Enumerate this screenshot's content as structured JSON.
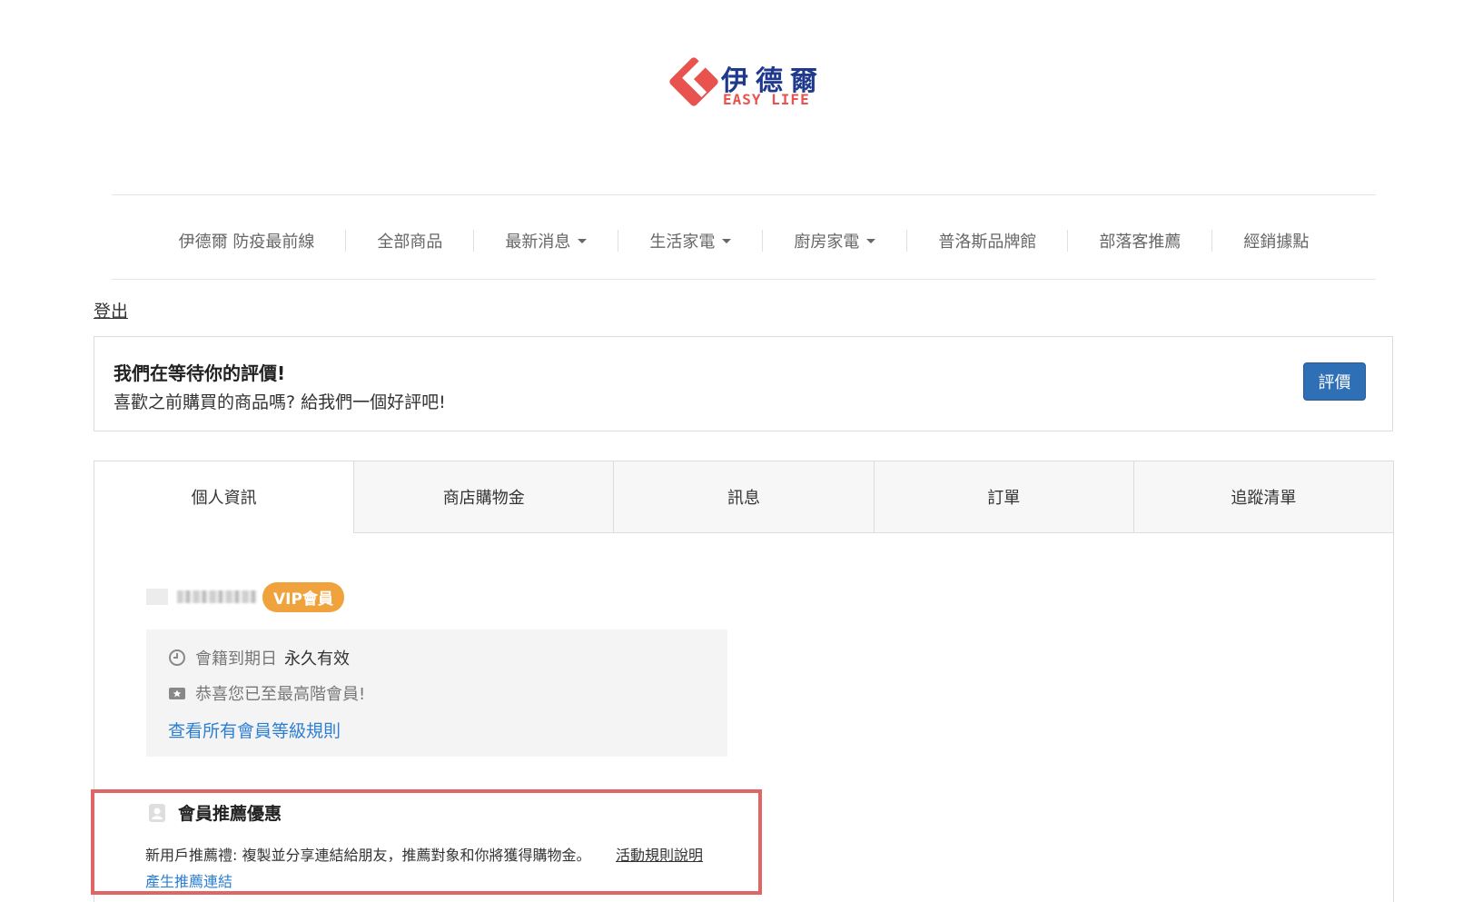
{
  "logo": {
    "chinese": "伊德爾",
    "english": "EASY LIFE",
    "brand_red": "#e8524f",
    "brand_blue": "#1f3a8c"
  },
  "nav": {
    "items": [
      {
        "label": "伊德爾 防疫最前線",
        "dropdown": false
      },
      {
        "label": "全部商品",
        "dropdown": false
      },
      {
        "label": "最新消息",
        "dropdown": true
      },
      {
        "label": "生活家電",
        "dropdown": true
      },
      {
        "label": "廚房家電",
        "dropdown": true
      },
      {
        "label": "普洛斯品牌館",
        "dropdown": false
      },
      {
        "label": "部落客推薦",
        "dropdown": false
      },
      {
        "label": "經銷據點",
        "dropdown": false
      }
    ]
  },
  "logout_label": "登出",
  "review": {
    "title": "我們在等待你的評價!",
    "description": "喜歡之前購買的商品嗎? 給我們一個好評吧!",
    "button_label": "評價"
  },
  "tabs": [
    {
      "label": "個人資訊",
      "active": true
    },
    {
      "label": "商店購物金",
      "active": false
    },
    {
      "label": "訊息",
      "active": false
    },
    {
      "label": "訂單",
      "active": false
    },
    {
      "label": "追蹤清單",
      "active": false
    }
  ],
  "member": {
    "badge": "VIP會員",
    "expiry_label": "會籍到期日",
    "expiry_value": "永久有效",
    "tier_message": "恭喜您已至最高階會員!",
    "rules_link": "查看所有會員等級規則"
  },
  "referral": {
    "title": "會員推薦優惠",
    "description": "新用戶推薦禮: 複製並分享連結給朋友，推薦對象和你將獲得購物金。",
    "rules_link": "活動規則說明",
    "generate_link": "產生推薦連結"
  },
  "colors": {
    "accent_blue": "#2f6fb6",
    "link_blue": "#2d7fd3",
    "vip_orange": "#f0a33c",
    "highlight_red": "#e06666"
  }
}
